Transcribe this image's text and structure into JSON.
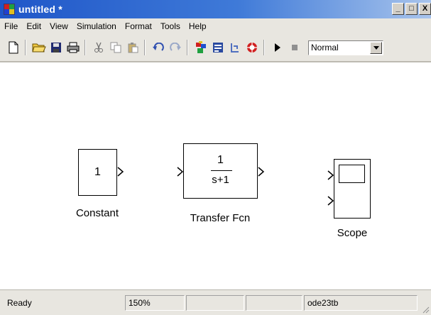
{
  "window": {
    "title": "untitled *",
    "buttons": {
      "minimize": "_",
      "maximize": "□",
      "close": "X"
    }
  },
  "menu": [
    "File",
    "Edit",
    "View",
    "Simulation",
    "Format",
    "Tools",
    "Help"
  ],
  "toolbar": {
    "icons": [
      "new-file-icon",
      "open-folder-icon",
      "save-icon",
      "print-icon",
      "cut-icon",
      "copy-icon",
      "paste-icon",
      "undo-icon",
      "redo-icon",
      "library-browser-icon",
      "model-explorer-icon",
      "debug-icon",
      "signal-icon",
      "start-simulation-icon",
      "stop-simulation-icon"
    ],
    "mode": "Normal"
  },
  "blocks": {
    "constant": {
      "value": "1",
      "label": "Constant"
    },
    "transfer_fcn": {
      "numerator": "1",
      "denominator": "s+1",
      "label": "Transfer Fcn"
    },
    "scope": {
      "label": "Scope"
    }
  },
  "statusbar": {
    "status": "Ready",
    "zoom": "150%",
    "solver": "ode23tb"
  }
}
